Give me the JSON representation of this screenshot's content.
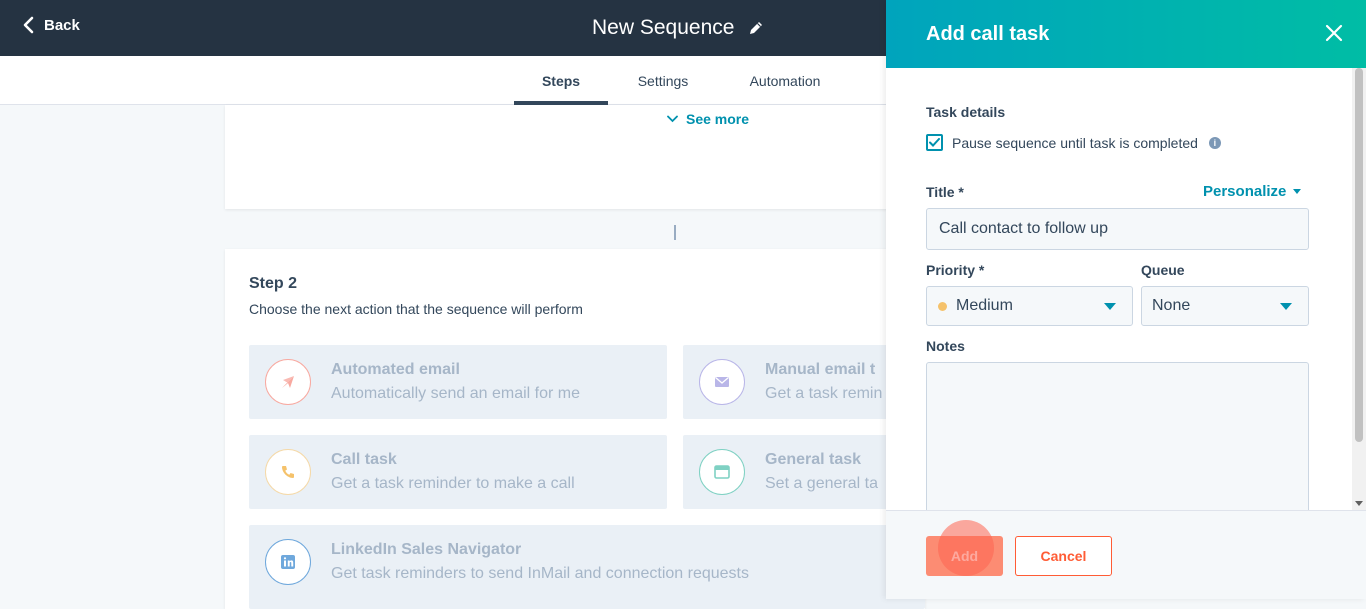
{
  "header": {
    "back_label": "Back",
    "sequence_title": "New Sequence"
  },
  "tabs": [
    {
      "label": "Steps",
      "active": true
    },
    {
      "label": "Settings",
      "active": false
    },
    {
      "label": "Automation",
      "active": false
    }
  ],
  "main": {
    "see_more_label": "See more",
    "step": {
      "heading": "Step 2",
      "subtitle": "Choose the next action that the sequence will perform",
      "actions": [
        {
          "title": "Automated email",
          "description": "Automatically send an email for me",
          "icon": "paper-plane-icon",
          "color": "#f8a9a0"
        },
        {
          "title": "Manual email t",
          "description": "Get a task remin",
          "icon": "envelope-icon",
          "color": "#b9b6e8"
        },
        {
          "title": "Call task",
          "description": "Get a task reminder to make a call",
          "icon": "phone-icon",
          "color": "#f5c26b"
        },
        {
          "title": "General task",
          "description": "Set a general ta",
          "icon": "monitor-icon",
          "color": "#7fd1c3"
        },
        {
          "title": "LinkedIn Sales Navigator",
          "description": "Get task reminders to send InMail and connection requests",
          "icon": "linkedin-icon",
          "color": "#6fa8dc"
        }
      ]
    }
  },
  "panel": {
    "title": "Add call task",
    "task_details_label": "Task details",
    "pause_checkbox_label": "Pause sequence until task is completed",
    "pause_checked": true,
    "title_label": "Title *",
    "personalize_label": "Personalize",
    "title_value": "Call contact to follow up",
    "priority_label": "Priority *",
    "priority_value": "Medium",
    "priority_color": "#f5c26b",
    "queue_label": "Queue",
    "queue_value": "None",
    "notes_label": "Notes",
    "notes_value": "",
    "add_label": "Add",
    "cancel_label": "Cancel"
  },
  "colors": {
    "header_bg": "#253342",
    "accent": "#0091ae",
    "panel_gradient_start": "#00a4bd",
    "panel_gradient_end": "#00bda5",
    "primary_button": "#fe7a5c"
  }
}
